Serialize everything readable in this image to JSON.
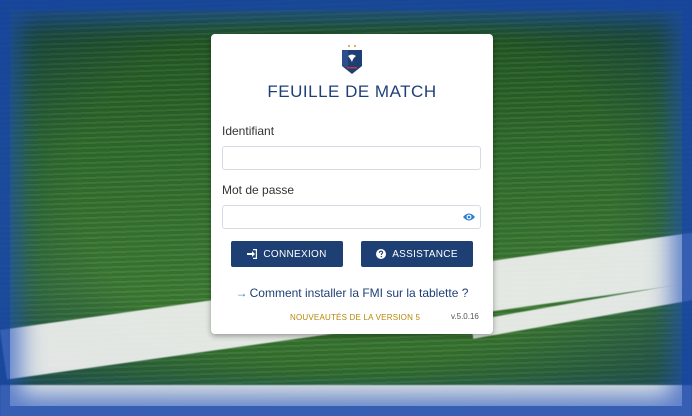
{
  "app": {
    "title": "FEUILLE DE MATCH"
  },
  "form": {
    "identifier_label": "Identifiant",
    "identifier_value": "",
    "password_label": "Mot de passe",
    "password_value": ""
  },
  "buttons": {
    "login_label": "CONNEXION",
    "assistance_label": "ASSISTANCE"
  },
  "links": {
    "install_arrow": "→",
    "install_label": "Comment installer la FMI sur la tablette ?"
  },
  "footer": {
    "news_label": "NOUVEAUTÉS DE LA VERSION 5",
    "version": "v.5.0.16"
  },
  "icons": {
    "logo": "fff-crest-icon",
    "password_toggle": "eye-icon",
    "login": "sign-in-icon",
    "assistance": "question-circle-icon"
  },
  "colors": {
    "primary": "#1e3f73",
    "title": "#1f3f78",
    "link_arrow": "#2e7fd0",
    "news": "#b8860b"
  }
}
